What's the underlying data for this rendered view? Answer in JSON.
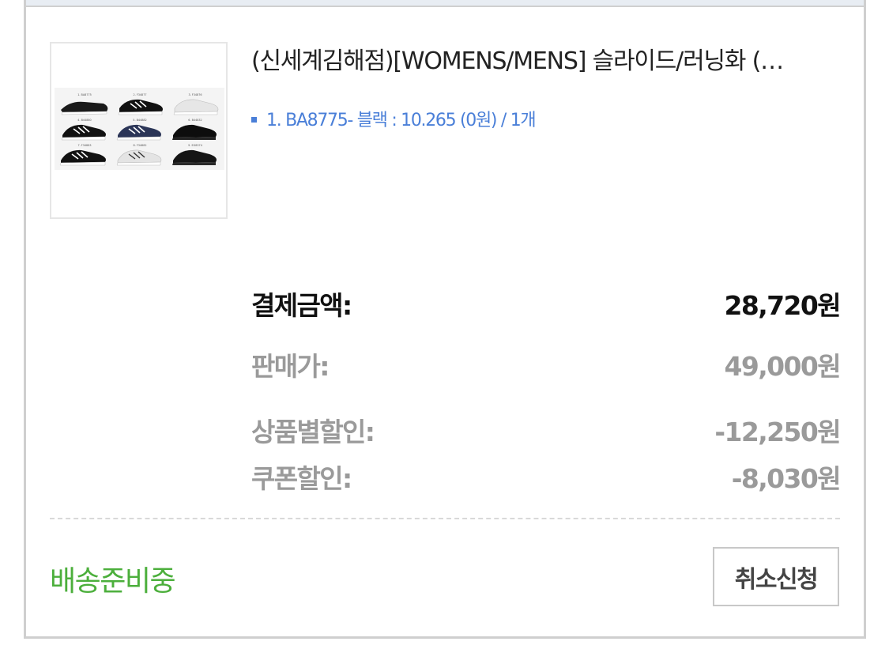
{
  "order_item": {
    "title": "(신세계김해점)[WOMENS/MENS] 슬라이드/러닝화 (…",
    "option_text": "1. BA8775- 블랙 : 10.265 (0원) / 1개",
    "thumbnail": {
      "labels": [
        "1. BA8775",
        "2. F34877",
        "3. F34876",
        "4. B44880",
        "5. B44882",
        "6. B44832",
        "7. F34883",
        "8. F34882",
        "9. EG8374"
      ]
    }
  },
  "summary": {
    "payment_label": "결제금액:",
    "payment_value": "28,720원",
    "sale_price_label": "판매가:",
    "sale_price_value": "49,000원",
    "product_discount_label": "상품별할인:",
    "product_discount_value": "-12,250원",
    "coupon_discount_label": "쿠폰할인:",
    "coupon_discount_value": "-8,030원"
  },
  "footer": {
    "status": "배송준비중",
    "cancel_button": "취소신청"
  },
  "colors": {
    "status_green": "#4caf3c",
    "option_blue": "#4a7fd8",
    "muted_gray": "#9a9a9a"
  }
}
